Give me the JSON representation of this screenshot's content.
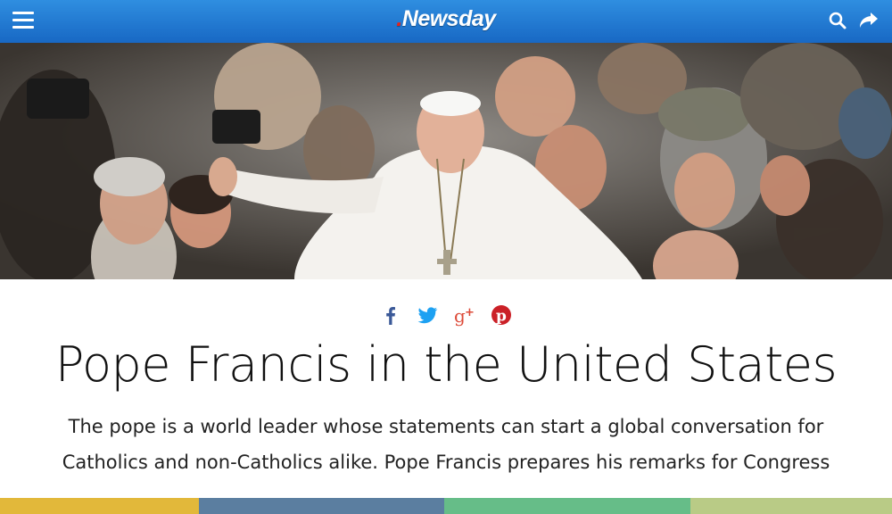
{
  "header": {
    "logo_dot": ".",
    "logo_text": "Newsday",
    "menu_icon": "hamburger-menu-icon",
    "search_icon": "search-icon",
    "share_icon": "share-arrow-icon",
    "bar_color": "#1e73cf"
  },
  "hero": {
    "subject": "photo"
  },
  "social": {
    "icons": [
      "facebook-icon",
      "twitter-icon",
      "google-plus-icon",
      "pinterest-icon"
    ],
    "colors": {
      "facebook": "#3b5998",
      "twitter": "#1da1f2",
      "google_plus": "#dd4b39",
      "pinterest": "#cb2027"
    }
  },
  "article": {
    "title": "Pope Francis in the United States",
    "dek_line1": "The pope is a world leader whose statements can start a global conversation for",
    "dek_line2": "Catholics and non-Catholics alike. Pope Francis prepares his remarks for Congress"
  },
  "color_bar": [
    "#e2b83a",
    "#5b7ea0",
    "#66bd88",
    "#b9cb86"
  ]
}
